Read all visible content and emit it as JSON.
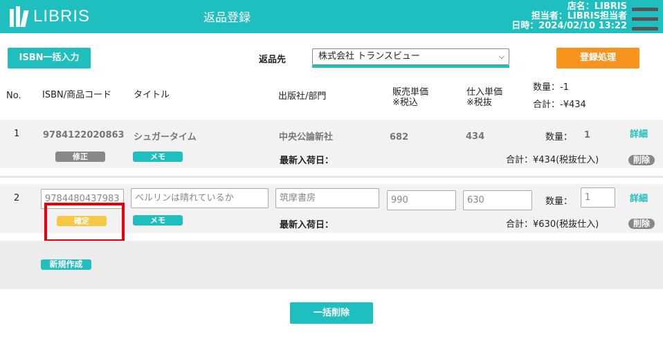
{
  "header": {
    "logo_text": "LIBRIS",
    "title": "返品登録",
    "store": "店名：LIBRIS",
    "staff": "担当者：LIBRIS担当者",
    "datetime": "日時：2024/02/10  13:22"
  },
  "toolbar": {
    "isbn_bulk_label": "ISBN一括入力",
    "return_to_label": "返品先",
    "return_to_value": "株式会社 トランスビュー",
    "register_label": "登録処理"
  },
  "columns": {
    "no": "No.",
    "isbn": "ISBN/商品コード",
    "title": "タイトル",
    "publisher": "出版社/部門",
    "sale_price": "販売単価",
    "sale_price_note": "※税込",
    "cost_price": "仕入単価",
    "cost_price_note": "※税抜",
    "total_qty": "数量：-1",
    "total_sum": "合計：-¥434"
  },
  "rows": [
    {
      "no": "1",
      "isbn": "9784122020863",
      "title": "シュガータイム",
      "publisher": "中央公論新社",
      "sale_price": "682",
      "cost_price": "434",
      "qty_label": "数量：",
      "qty": "1",
      "detail": "詳細",
      "edit": "修正",
      "memo": "メモ",
      "latest_arrival": "最新入荷日：",
      "subtotal": "合計：¥434(税抜仕入)",
      "delete": "削除"
    },
    {
      "no": "2",
      "isbn": "9784480437983",
      "title": "ベルリンは晴れているか",
      "publisher": "筑摩書房",
      "sale_price": "990",
      "cost_price": "630",
      "qty_label": "数量：",
      "qty": "1",
      "detail": "詳細",
      "confirm": "確定",
      "memo": "メモ",
      "latest_arrival": "最新入荷日：",
      "subtotal": "合計：¥630(税抜仕入)",
      "delete": "削除"
    }
  ],
  "new_create_label": "新規作成",
  "bulk_delete_label": "一括削除",
  "colors": {
    "accent": "#1fbfbf",
    "orange": "#f7941d",
    "confirm": "#f6c945",
    "highlight": "#e8000b"
  }
}
